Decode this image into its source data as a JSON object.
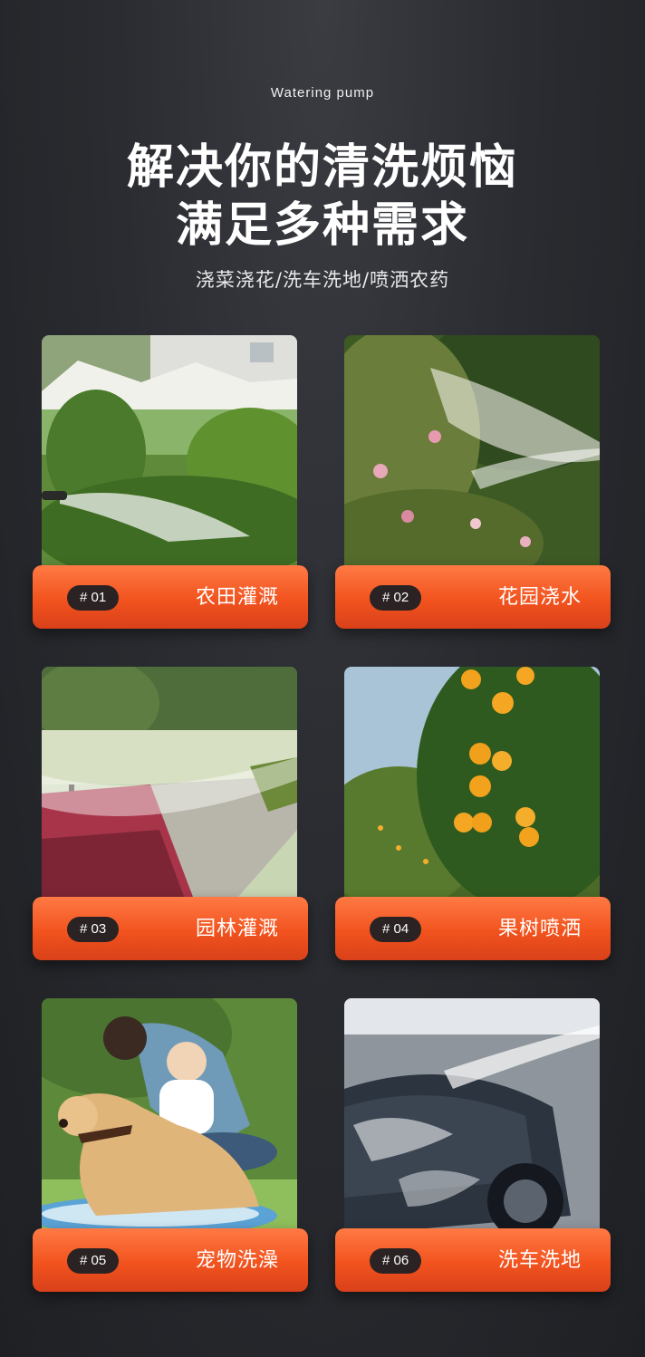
{
  "header": {
    "english_title": "Watering pump",
    "title_line1": "解决你的清洗烦恼",
    "title_line2": "满足多种需求",
    "tagline": "浇菜浇花/洗车洗地/喷洒农药"
  },
  "cards": [
    {
      "number": "# 01",
      "label": "农田灌溉"
    },
    {
      "number": "# 02",
      "label": "花园浇水"
    },
    {
      "number": "# 03",
      "label": "园林灌溉"
    },
    {
      "number": "# 04",
      "label": "果树喷洒"
    },
    {
      "number": "# 05",
      "label": "宠物洗澡"
    },
    {
      "number": "# 06",
      "label": "洗车洗地"
    }
  ],
  "colors": {
    "background": "#2a2c31",
    "accent": "#f2531e",
    "badge": "#2b2323"
  }
}
